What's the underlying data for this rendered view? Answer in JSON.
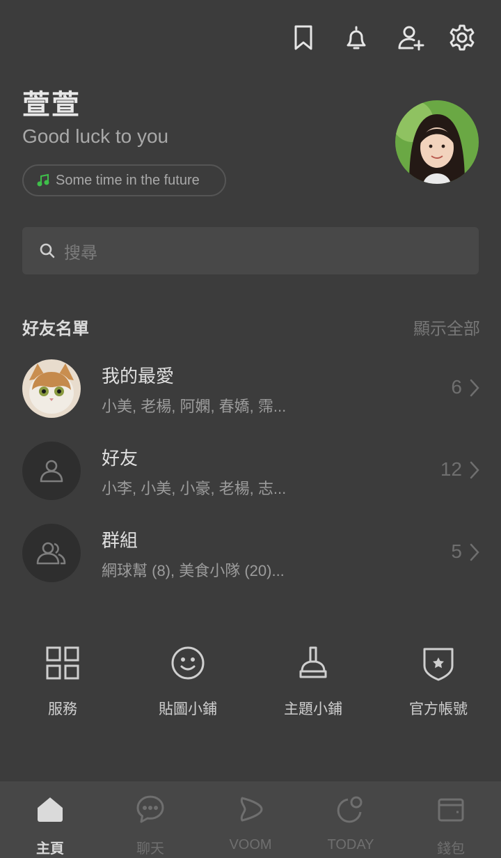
{
  "header": {
    "icons": [
      "bookmark-icon",
      "bell-icon",
      "add-friend-icon",
      "gear-icon"
    ]
  },
  "profile": {
    "name": "萱萱",
    "status": "Good luck to you",
    "music": "Some time in the future",
    "music_icon_color": "#3fbf4a"
  },
  "search": {
    "placeholder": "搜尋"
  },
  "friends_section": {
    "title": "好友名單",
    "show_all": "顯示全部",
    "rows": [
      {
        "title": "我的最愛",
        "subtitle": "小美, 老楊, 阿嫻, 春嬌, 霈...",
        "count": "6"
      },
      {
        "title": "好友",
        "subtitle": "小李, 小美, 小豪, 老楊, 志...",
        "count": "12"
      },
      {
        "title": "群組",
        "subtitle": "網球幫 (8), 美食小隊 (20)...",
        "count": "5"
      }
    ]
  },
  "services": [
    {
      "label": "服務",
      "icon": "grid-icon"
    },
    {
      "label": "貼圖小鋪",
      "icon": "smile-icon"
    },
    {
      "label": "主題小鋪",
      "icon": "brush-icon"
    },
    {
      "label": "官方帳號",
      "icon": "shield-star-icon"
    }
  ],
  "bottom_nav": [
    {
      "label": "主頁",
      "icon": "home-icon",
      "active": true
    },
    {
      "label": "聊天",
      "icon": "chat-icon",
      "active": false
    },
    {
      "label": "VOOM",
      "icon": "voom-icon",
      "active": false
    },
    {
      "label": "TODAY",
      "icon": "today-icon",
      "active": false
    },
    {
      "label": "錢包",
      "icon": "wallet-icon",
      "active": false
    }
  ]
}
